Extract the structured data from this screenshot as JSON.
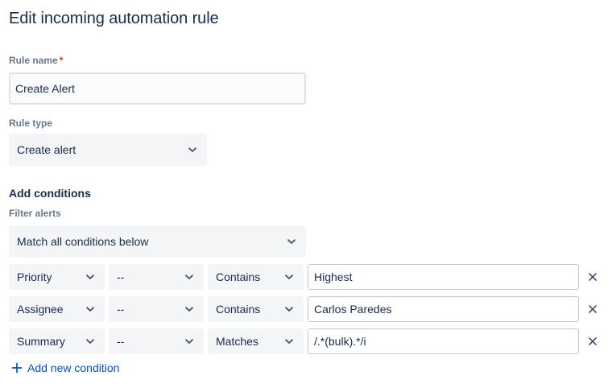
{
  "page": {
    "title": "Edit incoming automation rule"
  },
  "rule_name": {
    "label": "Rule name",
    "required_mark": "*",
    "value": "Create Alert"
  },
  "rule_type": {
    "label": "Rule type",
    "value": "Create alert"
  },
  "conditions": {
    "section_title": "Add conditions",
    "filter_label": "Filter alerts",
    "match_value": "Match all conditions below",
    "rows": [
      {
        "field": "Priority",
        "not": "--",
        "operator": "Contains",
        "value": "Highest"
      },
      {
        "field": "Assignee",
        "not": "--",
        "operator": "Contains",
        "value": "Carlos Paredes"
      },
      {
        "field": "Summary",
        "not": "--",
        "operator": "Matches",
        "value": "/.*(bulk).*/i"
      }
    ],
    "add_label": "Add new condition"
  },
  "icons": {
    "chevron": "chevron-down-icon",
    "remove": "close-icon",
    "add": "plus-icon"
  },
  "colors": {
    "link": "#0052cc",
    "required": "#de350b",
    "text": "#172b4d",
    "muted": "#6b778c"
  }
}
